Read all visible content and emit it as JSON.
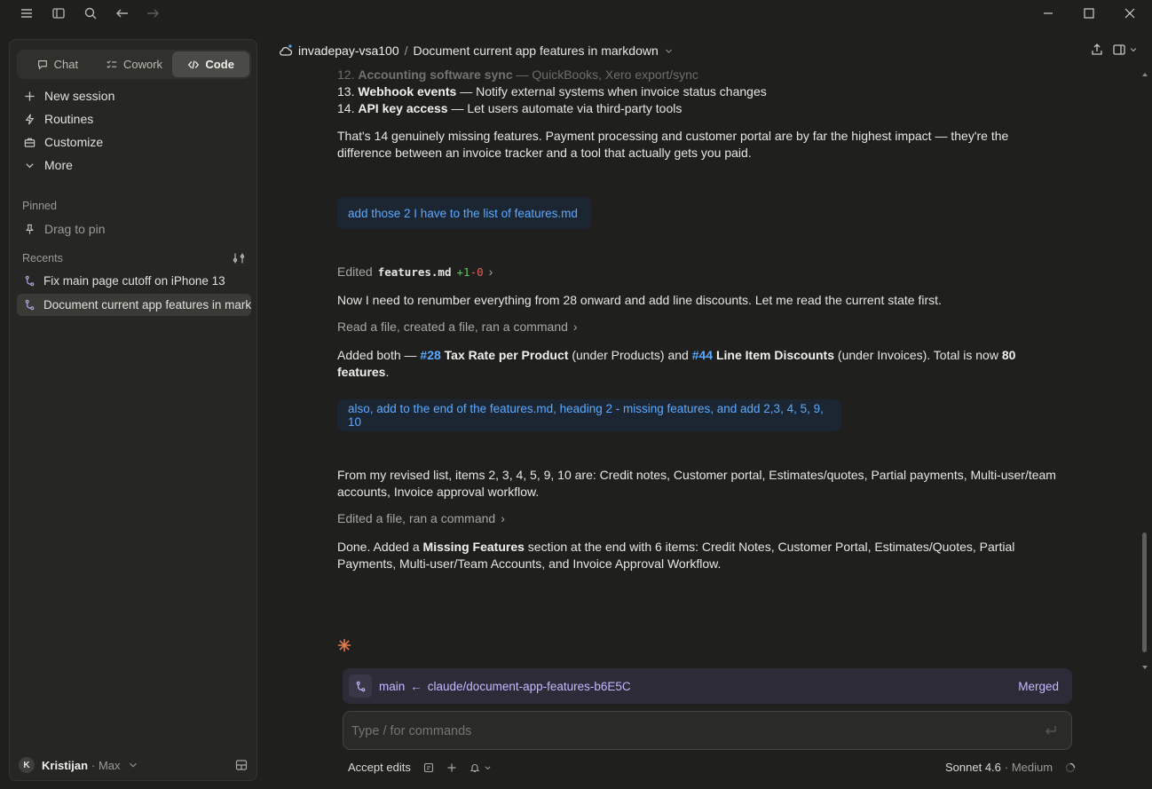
{
  "app": {
    "repo": "invadepay-vsa100",
    "separator": "/",
    "session_title": "Document current app features in markdown"
  },
  "sidebar": {
    "modes": [
      {
        "label": "Chat"
      },
      {
        "label": "Cowork"
      },
      {
        "label": "Code"
      }
    ],
    "nav": [
      {
        "label": "New session"
      },
      {
        "label": "Routines"
      },
      {
        "label": "Customize"
      },
      {
        "label": "More"
      }
    ],
    "pinned_label": "Pinned",
    "pinned_placeholder": "Drag to pin",
    "recents_label": "Recents",
    "recents": [
      {
        "label": "Fix main page cutoff on iPhone 13"
      },
      {
        "label": "Document current app features in markdown"
      }
    ],
    "user": {
      "initial": "K",
      "name": "Kristijan",
      "plan": "· Max"
    }
  },
  "conversation": {
    "item12": {
      "num": "12.",
      "title": "Accounting software sync",
      "desc": " — QuickBooks, Xero export/sync"
    },
    "item13": {
      "num": "13.",
      "title": "Webhook events",
      "desc": " — Notify external systems when invoice status changes"
    },
    "item14": {
      "num": "14.",
      "title": "API key access",
      "desc": " — Let users automate via third-party tools"
    },
    "summary": "That's 14 genuinely missing features. Payment processing and customer portal are by far the highest impact — they're the difference between an invoice tracker and a tool that actually gets you paid.",
    "user_msg_1": "add those 2 I have to the list of features.md",
    "edit_line": {
      "prefix": "Edited",
      "file": "features.md",
      "added": "+1",
      "removed": "-0",
      "chevron": "›"
    },
    "renumber": "Now I need to renumber everything from 28 onward and add line discounts. Let me read the current state first.",
    "tools_1": "Read a file, created a file, ran a command",
    "added": {
      "p1": "Added both — ",
      "ref1": "#28",
      "b1": " Tax Rate per Product",
      "p2": " (under Products) and ",
      "ref2": "#44",
      "b2": " Line Item Discounts",
      "p3": " (under Invoices). Total is now ",
      "b3": "80 features",
      "p4": "."
    },
    "user_msg_2": "also, add to the end of the features.md, heading 2 - missing features, and add 2,3, 4, 5, 9, 10",
    "revised": "From my revised list, items 2, 3, 4, 5, 9, 10 are: Credit notes, Customer portal, Estimates/quotes, Partial payments, Multi-user/team accounts, Invoice approval workflow.",
    "tools_2": "Edited a file, ran a command",
    "done": {
      "p1": "Done. Added a ",
      "b1": "Missing Features",
      "p2": " section at the end with 6 items: Credit Notes, Customer Portal, Estimates/Quotes, Partial Payments, Multi-user/Team Accounts, and Invoice Approval Workflow."
    }
  },
  "branch": {
    "base": "main",
    "arrow": "←",
    "head": "claude/document-app-features-b6E5C",
    "status": "Merged"
  },
  "composer": {
    "placeholder": "Type / for commands",
    "mode": "Accept edits",
    "model": "Sonnet 4.6",
    "effort": "· Medium"
  },
  "colors": {
    "accent_blue": "#5aa9ff",
    "accent_purple": "#c6b9ff",
    "diff_add": "#5ec46a",
    "diff_remove": "#e0625a",
    "spark": "#e07b4a"
  }
}
